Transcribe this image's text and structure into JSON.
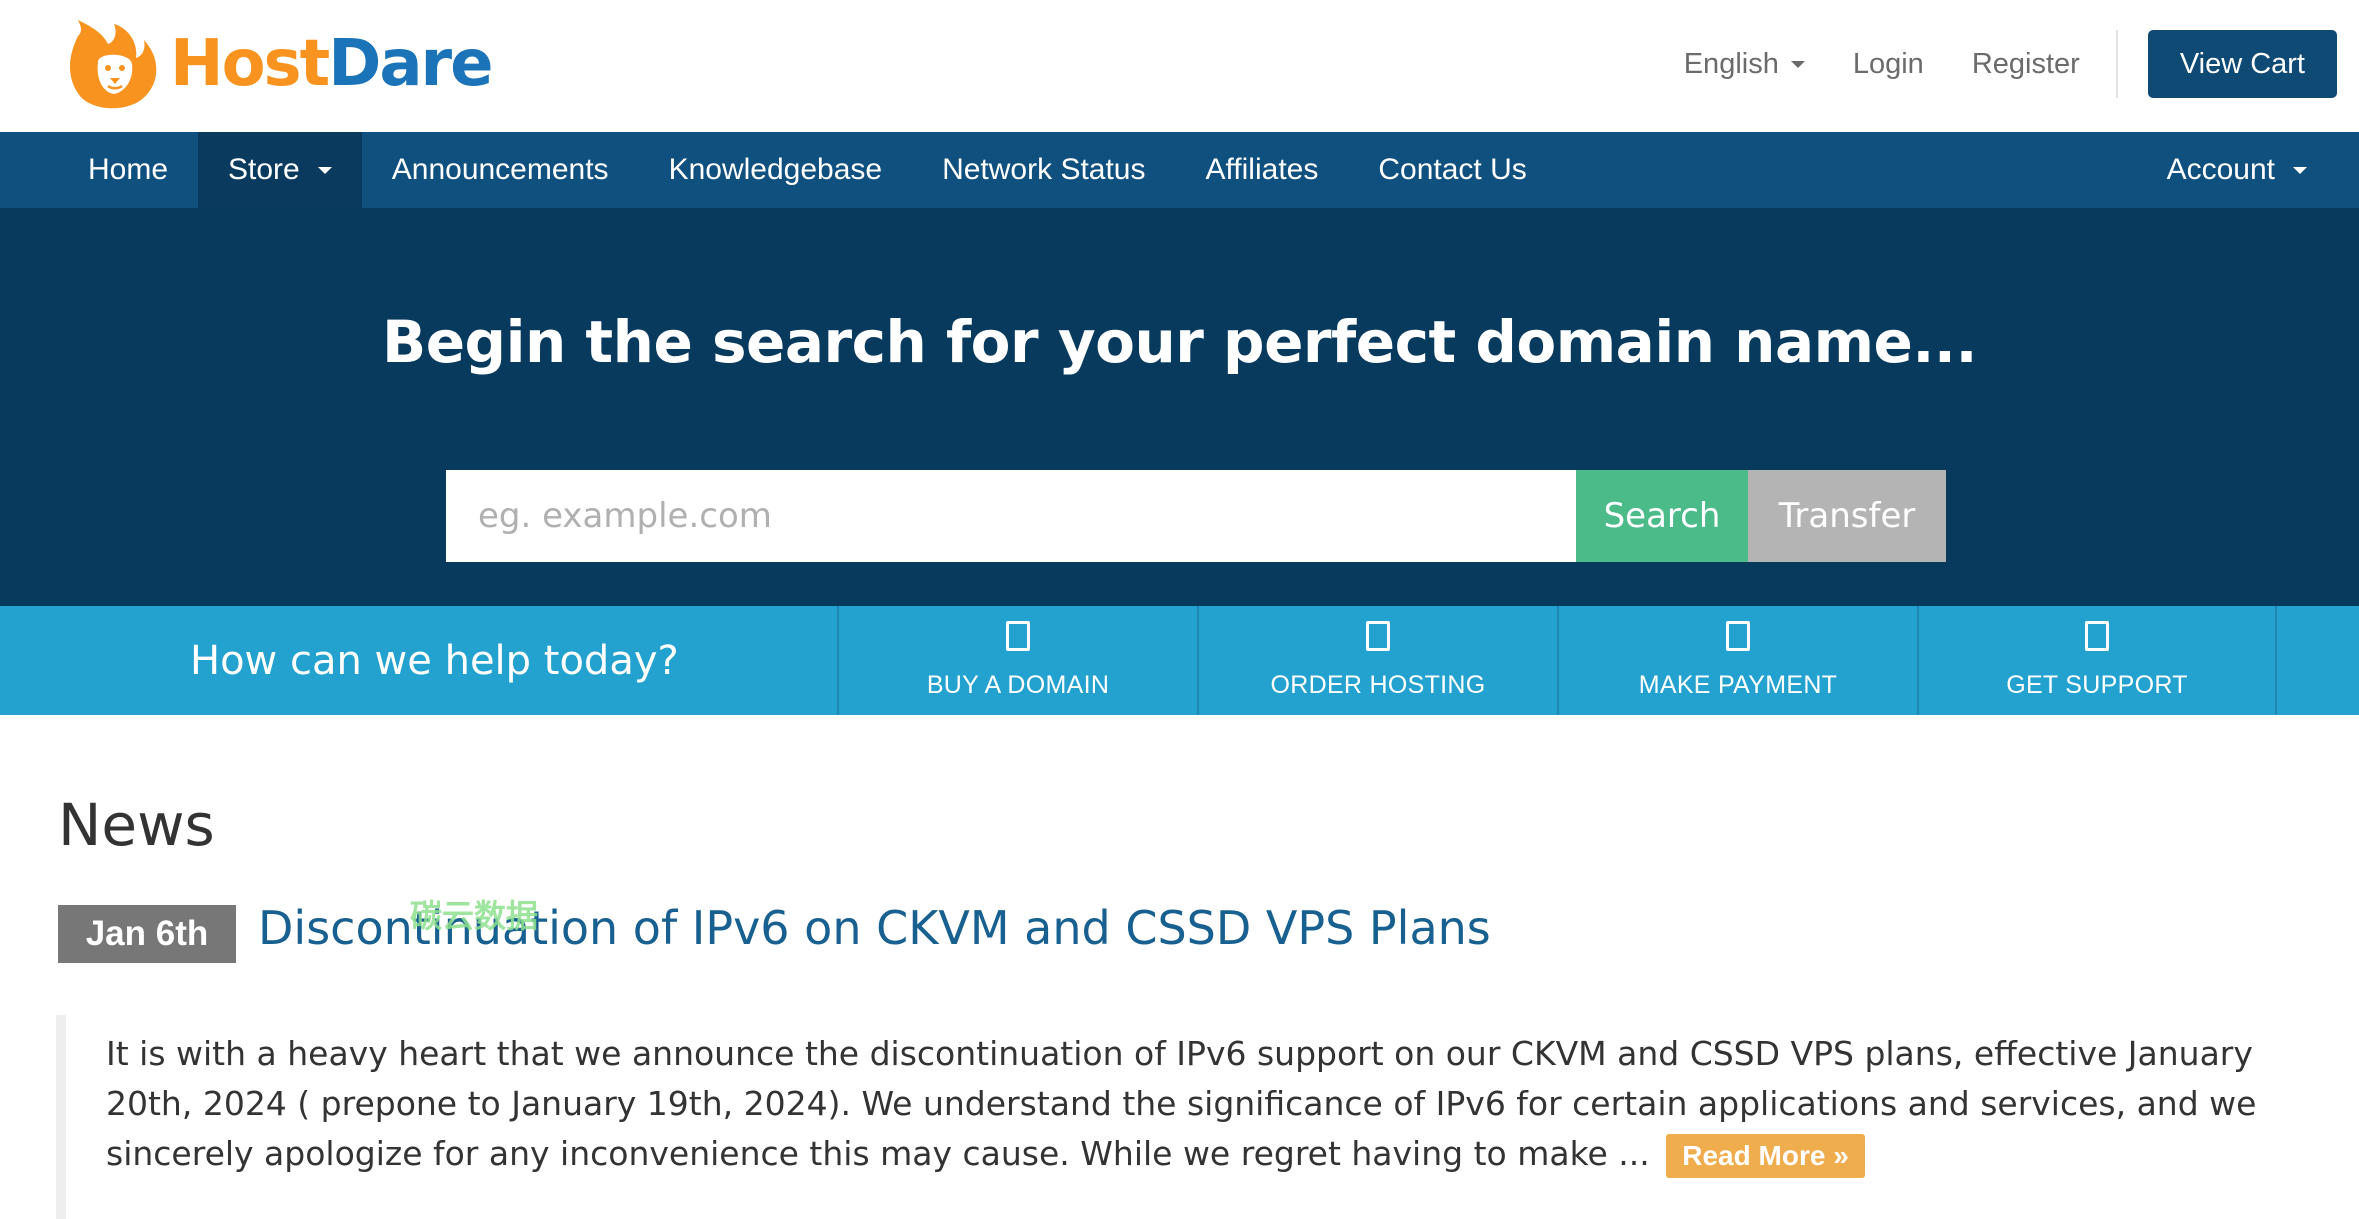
{
  "brand": {
    "host": "Host",
    "dare": "Dare",
    "icon": "lion-flame-logo"
  },
  "topnav": {
    "language": "English",
    "login": "Login",
    "register": "Register",
    "view_cart": "View Cart"
  },
  "mainnav": {
    "items": [
      {
        "label": "Home"
      },
      {
        "label": "Store"
      },
      {
        "label": "Announcements"
      },
      {
        "label": "Knowledgebase"
      },
      {
        "label": "Network Status"
      },
      {
        "label": "Affiliates"
      },
      {
        "label": "Contact Us"
      }
    ],
    "account": "Account"
  },
  "hero": {
    "title": "Begin the search for your perfect domain name...",
    "placeholder": "eg. example.com",
    "search": "Search",
    "transfer": "Transfer"
  },
  "help": {
    "title": "How can we help today?",
    "items": [
      {
        "label": "BUY A DOMAIN",
        "icon": "globe-icon"
      },
      {
        "label": "ORDER HOSTING",
        "icon": "server-icon"
      },
      {
        "label": "MAKE PAYMENT",
        "icon": "credit-card-icon"
      },
      {
        "label": "GET SUPPORT",
        "icon": "support-icon"
      }
    ]
  },
  "news": {
    "heading": "News",
    "watermark": "碳云数据",
    "items": [
      {
        "date": "Jan 6th",
        "title": "Discontinuation of IPv6 on CKVM and CSSD VPS Plans",
        "excerpt": "It is with a heavy heart that we announce the discontinuation of IPv6 support on our CKVM and CSSD VPS plans, effective January 20th, 2024 ( prepone to January 19th, 2024). We understand the significance of IPv6 for certain applications and services, and we sincerely apologize for any inconvenience this may cause. While we regret having to make ...",
        "read_more": "Read More »"
      }
    ]
  },
  "colors": {
    "nav_bg": "#10507e",
    "hero_bg": "#083a5e",
    "help_bg": "#24a2cf",
    "search_btn": "#4cbb8a",
    "transfer_btn": "#b4b4b4",
    "read_more": "#f0ad4e",
    "link": "#17608f",
    "brand_orange": "#f7931e",
    "brand_blue": "#1b73b8"
  }
}
